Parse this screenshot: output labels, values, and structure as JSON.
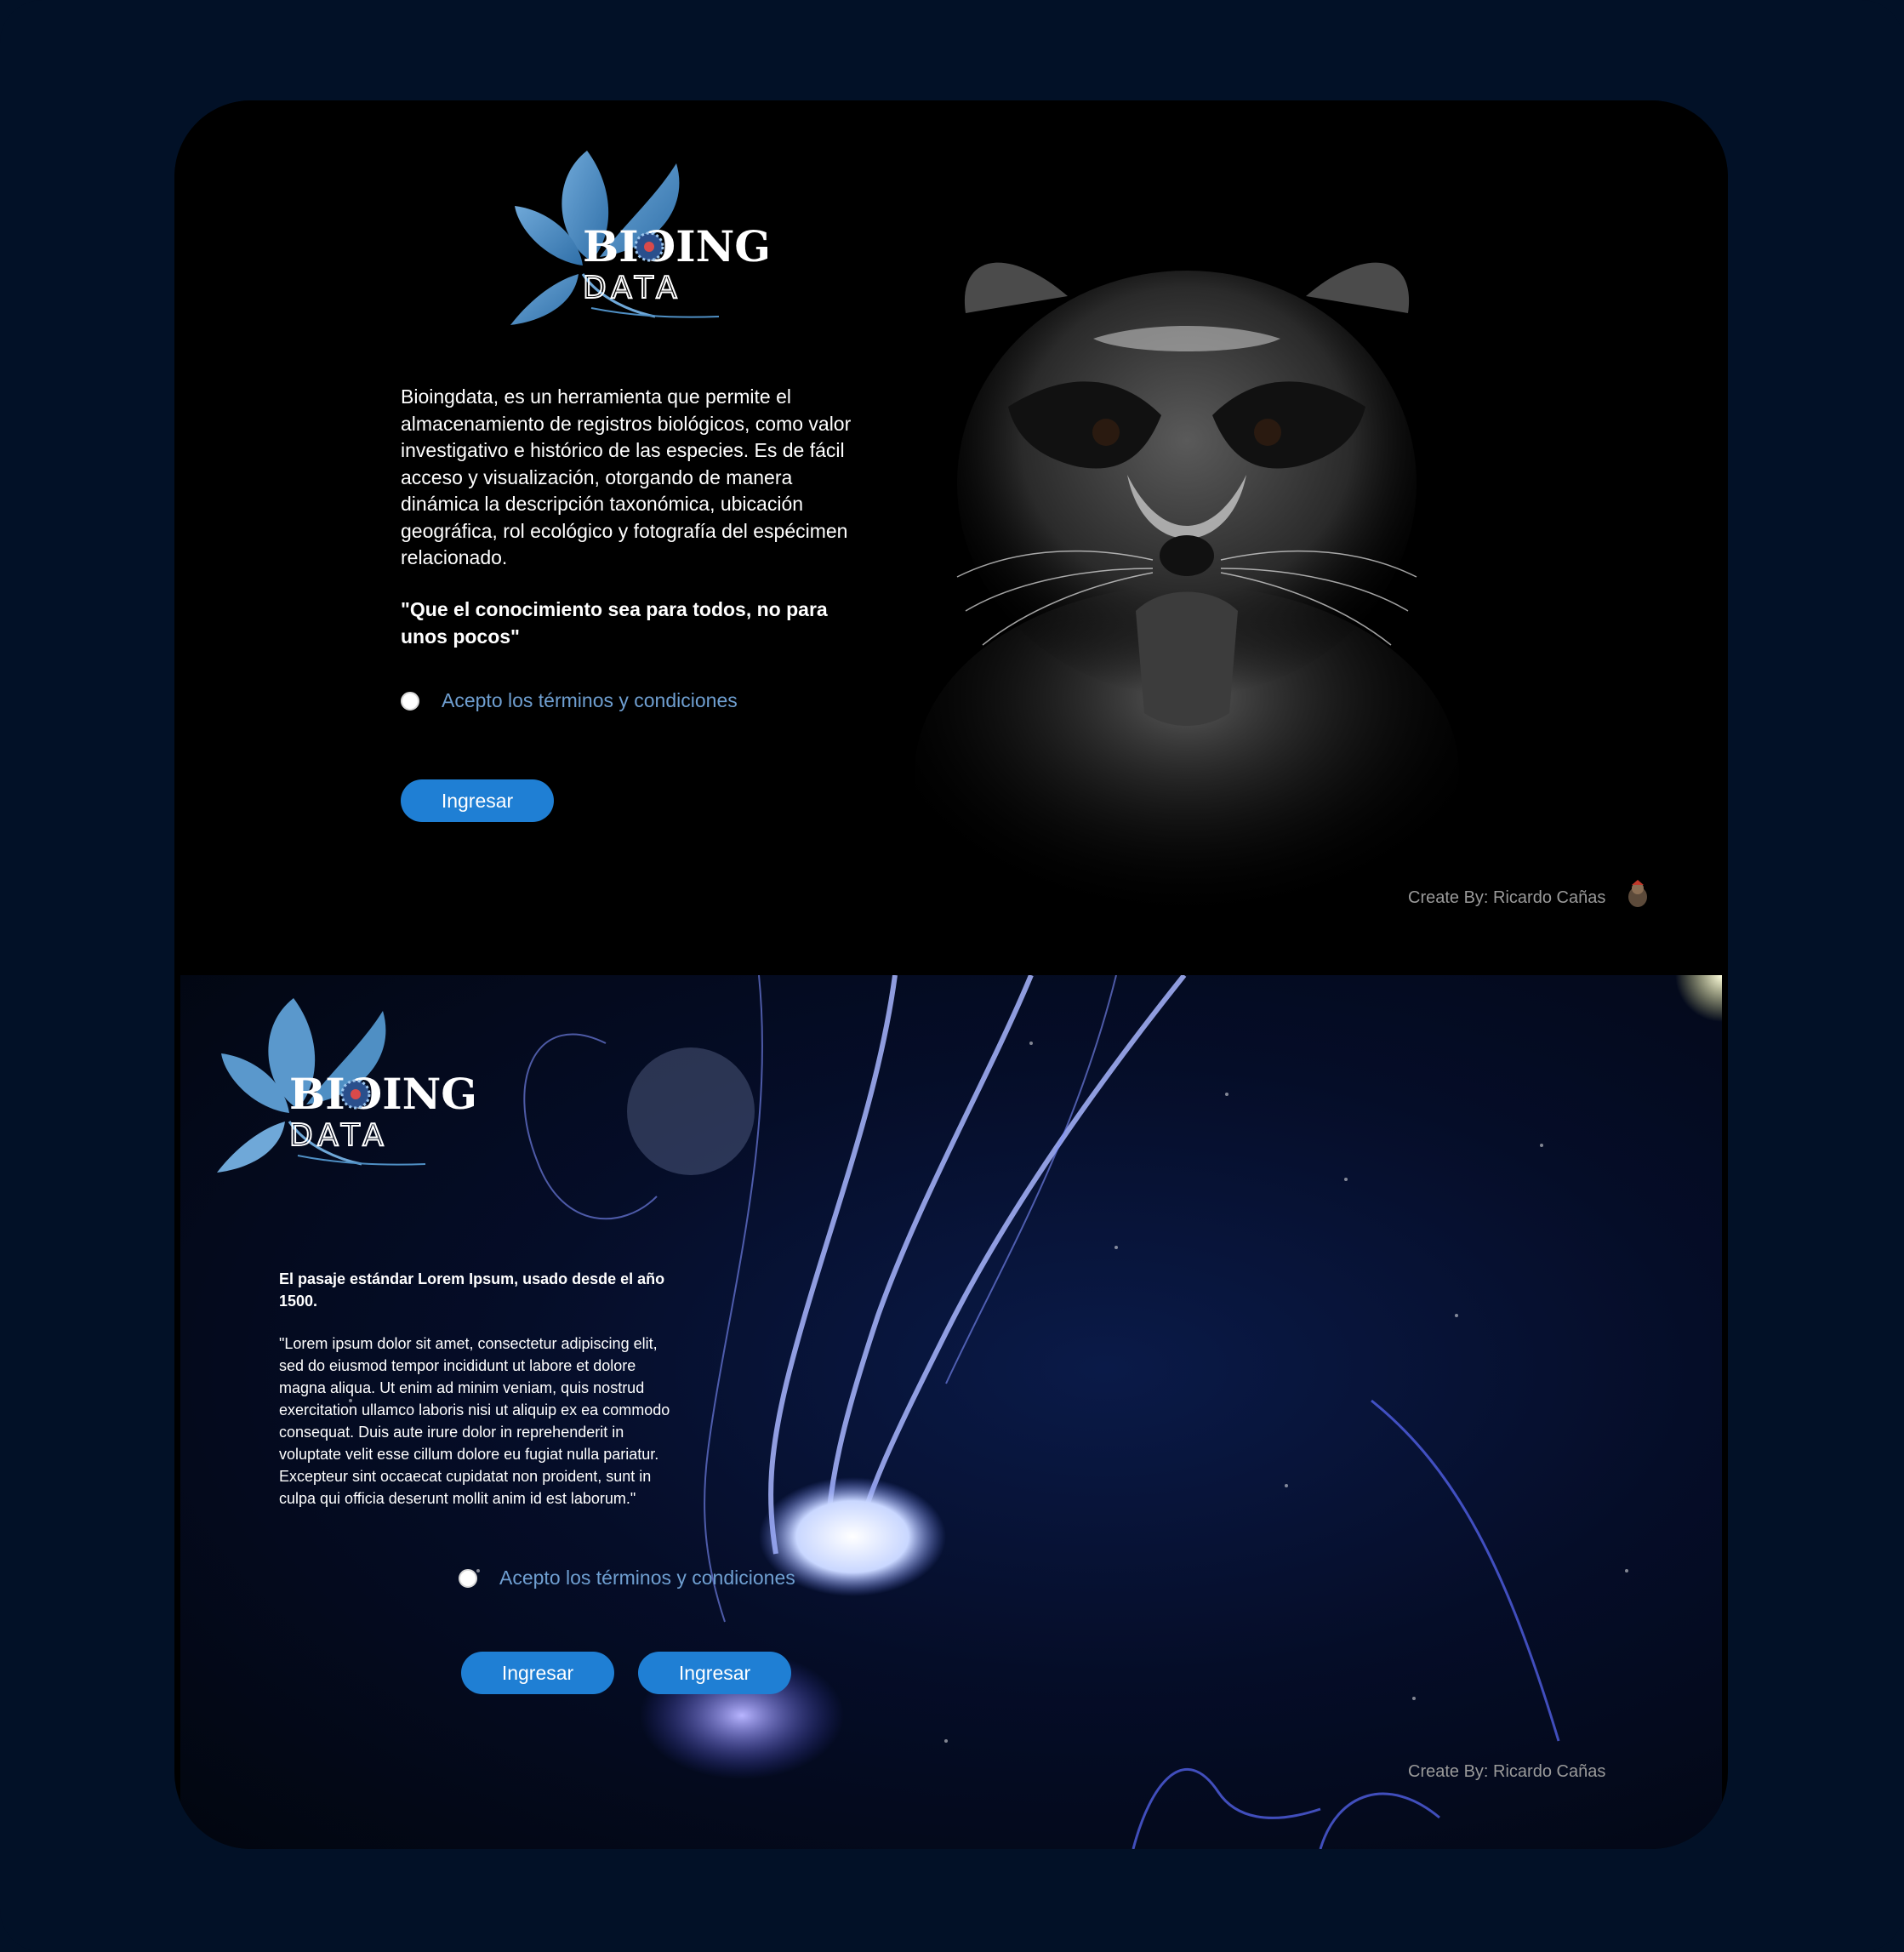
{
  "brand": {
    "logo_line1": "BIOING",
    "logo_line2": "DATA"
  },
  "top_screen": {
    "description": "Bioingdata, es un herramienta que permite el almacenamiento de registros biológicos, como valor investigativo e histórico de las especies. Es de fácil acceso y visualización, otorgando de manera dinámica la descripción taxonómica, ubicación geográfica, rol ecológico y fotografía del espécimen relacionado.",
    "quote": "\"Que el conocimiento sea para todos, no para unos pocos\"",
    "terms_label": "Acepto los términos y condiciones",
    "button_label": "Ingresar",
    "credit": "Create By: Ricardo Cañas",
    "hero_image": "raccoon-photo",
    "credit_icon": "avatar-icon"
  },
  "bottom_screen": {
    "heading": "El pasaje estándar Lorem Ipsum, usado desde el año 1500.",
    "body": "\"Lorem ipsum dolor sit amet, consectetur adipiscing elit, sed do eiusmod tempor incididunt ut labore et dolore magna aliqua. Ut enim ad minim veniam, quis nostrud exercitation ullamco laboris nisi ut aliquip ex ea commodo consequat. Duis  aute irure dolor in reprehenderit in voluptate velit esse cillum dolore eu fugiat nulla pariatur. Excepteur sint occaecat cupidatat non proident, sunt in culpa qui officia deserunt mollit anim id est laborum.\"",
    "terms_label": "Acepto los términos y condiciones",
    "button1_label": "Ingresar",
    "button2_label": "Ingresar",
    "credit": "Create By: Ricardo Cañas",
    "background_image": "jellyfish-photo"
  },
  "colors": {
    "page_background": "#021127",
    "button": "#1f7fd4",
    "terms_text": "#6f9fd1",
    "logo_leaf": "#4f8fc4"
  }
}
